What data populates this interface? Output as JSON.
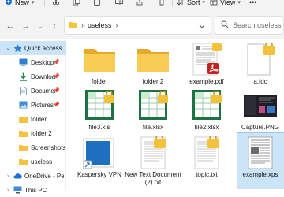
{
  "toolbar": {
    "new_label": "New",
    "sort_label": "Sort",
    "view_label": "View"
  },
  "address": {
    "crumbs": [
      "useless"
    ],
    "search_placeholder": "Search useless"
  },
  "sidebar": {
    "items": [
      {
        "label": "Quick access",
        "icon": "star-icon",
        "expanded": true,
        "selected": true,
        "pinned": false
      },
      {
        "label": "Desktop",
        "icon": "desktop-icon",
        "pinned": true
      },
      {
        "label": "Downloads",
        "icon": "download-icon",
        "pinned": true
      },
      {
        "label": "Documents",
        "icon": "document-icon",
        "pinned": true
      },
      {
        "label": "Pictures",
        "icon": "pictures-icon",
        "pinned": true
      },
      {
        "label": "folder",
        "icon": "folder-icon"
      },
      {
        "label": "folder 2",
        "icon": "folder-icon"
      },
      {
        "label": "Screenshots",
        "icon": "folder-icon"
      },
      {
        "label": "useless",
        "icon": "folder-icon"
      },
      {
        "label": "OneDrive - Person",
        "icon": "cloud-icon",
        "expanded": false
      },
      {
        "label": "This PC",
        "icon": "pc-icon",
        "expanded": false
      }
    ]
  },
  "files": [
    {
      "name": "folder",
      "icon": "folder-icon"
    },
    {
      "name": "folder 2",
      "icon": "folder-icon"
    },
    {
      "name": "example.pdf",
      "icon": "pdf-file-icon"
    },
    {
      "name": "a.fdc",
      "icon": "locked-file-icon"
    },
    {
      "name": "file3.xls",
      "icon": "excel-file-icon"
    },
    {
      "name": "file.xlsx",
      "icon": "excel-file-icon"
    },
    {
      "name": "file2.xlsx",
      "icon": "excel-file-icon"
    },
    {
      "name": "Capture.PNG",
      "icon": "image-file-icon"
    },
    {
      "name": "Kaspersky VPN",
      "icon": "shortcut-icon"
    },
    {
      "name": "New Text Document (2).txt",
      "icon": "text-file-icon"
    },
    {
      "name": "topic.txt",
      "icon": "text-file-icon"
    },
    {
      "name": "example.xps",
      "icon": "xps-file-icon",
      "selected": true
    }
  ],
  "colors": {
    "folder": "#f5c242",
    "lock": "#f4c23a",
    "excel": "#1e7145",
    "pdf": "#c5221f",
    "selection": "#cce4f7"
  }
}
